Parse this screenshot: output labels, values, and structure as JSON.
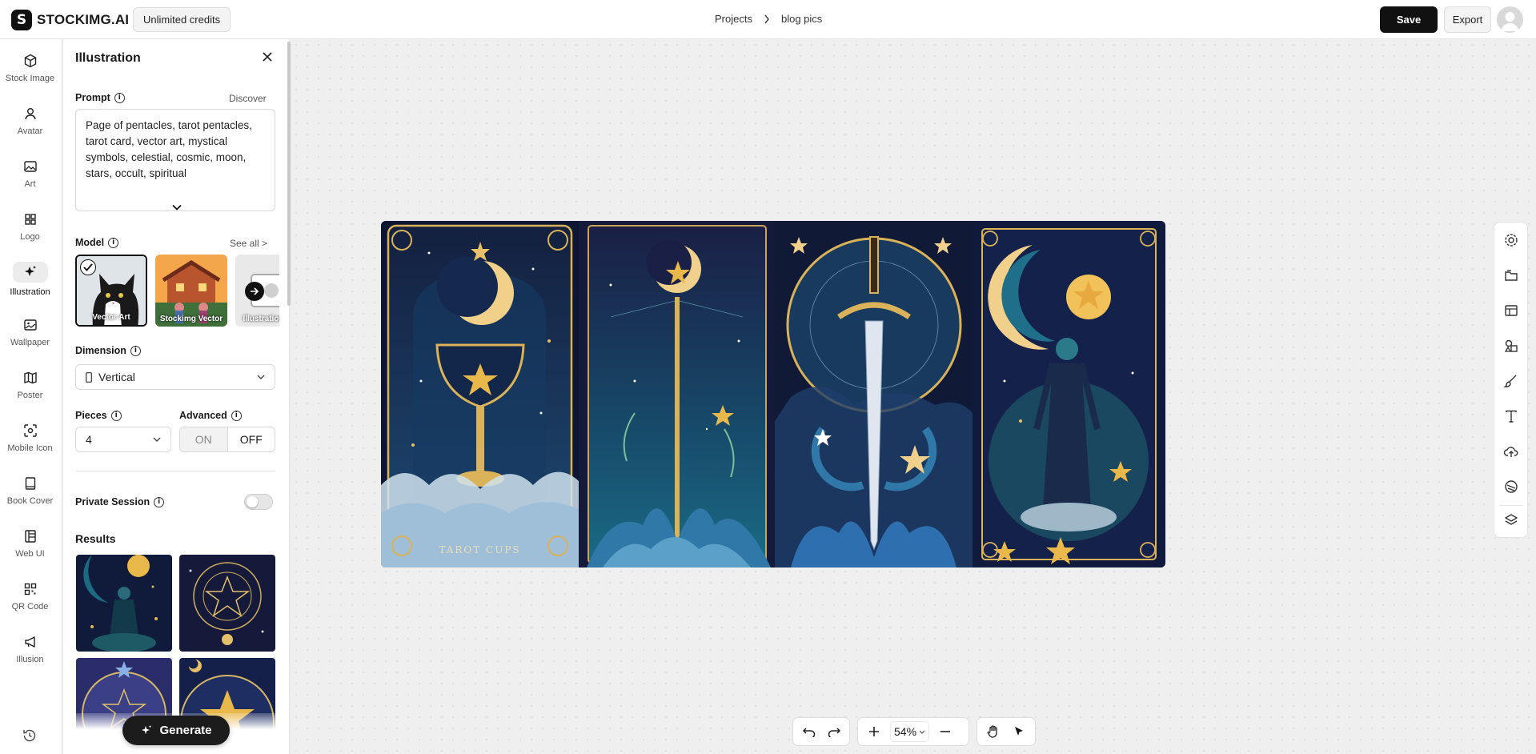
{
  "header": {
    "logo_letter": "S",
    "logo_text": "STOCKIMG.AI",
    "credits_badge": "Unlimited credits",
    "breadcrumb": [
      "Projects",
      "blog pics"
    ],
    "save_label": "Save",
    "export_label": "Export"
  },
  "nav": {
    "items": [
      {
        "label": "Stock Image",
        "icon": "cube-icon"
      },
      {
        "label": "Avatar",
        "icon": "person-icon"
      },
      {
        "label": "Art",
        "icon": "image-icon"
      },
      {
        "label": "Logo",
        "icon": "grid-icon"
      },
      {
        "label": "Illustration",
        "icon": "sparkle-icon",
        "active": true
      },
      {
        "label": "Wallpaper",
        "icon": "picture-icon"
      },
      {
        "label": "Poster",
        "icon": "map-icon"
      },
      {
        "label": "Mobile Icon",
        "icon": "scan-icon"
      },
      {
        "label": "Book Cover",
        "icon": "book-icon"
      },
      {
        "label": "Web UI",
        "icon": "layout-icon"
      },
      {
        "label": "QR Code",
        "icon": "qr-icon"
      },
      {
        "label": "Illusion",
        "icon": "megaphone-icon"
      }
    ]
  },
  "panel": {
    "title": "Illustration",
    "prompt_label": "Prompt",
    "discover_link": "Discover",
    "prompt_text": "Page of pentacles, tarot pentacles, tarot card, vector art, mystical symbols, celestial, cosmic, moon, stars, occult, spiritual",
    "model_label": "Model",
    "see_all_link": "See all >",
    "models": [
      {
        "name": "Vector Art",
        "selected": true
      },
      {
        "name": "Stockimg Vector",
        "selected": false
      },
      {
        "name": "Illustration",
        "selected": false
      }
    ],
    "dimension_label": "Dimension",
    "dimension_value": "Vertical",
    "pieces_label": "Pieces",
    "pieces_value": "4",
    "advanced_label": "Advanced",
    "advanced_on": "ON",
    "advanced_off": "OFF",
    "advanced_state": "OFF",
    "private_label": "Private Session",
    "private_enabled": false,
    "results_label": "Results",
    "generate_label": "Generate"
  },
  "canvas": {
    "zoom": "54%",
    "cards": [
      {
        "caption": "TAROT CUPS"
      }
    ]
  },
  "colors": {
    "accent": "#111111",
    "card_navy": "#0f1a3c",
    "card_gold": "#d9b25a",
    "card_teal": "#1f6f8b"
  }
}
